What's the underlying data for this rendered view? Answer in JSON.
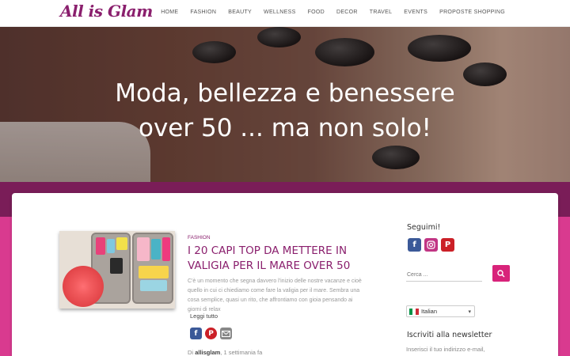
{
  "header": {
    "logo": "All is Glam",
    "nav": [
      "HOME",
      "FASHION",
      "BEAUTY",
      "WELLNESS",
      "FOOD",
      "DECOR",
      "TRAVEL",
      "EVENTS",
      "PROPOSTE SHOPPING"
    ]
  },
  "hero": {
    "line1": "Moda, bellezza e benessere",
    "line2": "over 50 ... ma non solo!"
  },
  "post": {
    "category": "FASHION",
    "title": "I 20 CAPI TOP DA METTERE IN VALIGIA PER IL MARE OVER 50",
    "excerpt": "C'è un momento che segna davvero l'inizio delle nostre vacanze e cioè quello in cui ci chiediamo come fare la valigia per il mare. Sembra una cosa semplice, quasi un rito, che affrontiamo con gioia pensando ai giorni di relax",
    "read_more": "Leggi tutto",
    "by_label": "Di",
    "author": "allisglam",
    "date": ", 1 settimania fa",
    "share_icons": [
      "facebook-icon",
      "pinterest-icon",
      "email-icon"
    ]
  },
  "sidebar": {
    "follow_title": "Seguimi!",
    "social_icons": [
      "facebook-icon",
      "instagram-icon",
      "pinterest-icon"
    ],
    "search_placeholder": "Cerca ...",
    "language": "Italian",
    "newsletter_title": "Iscriviti alla newsletter",
    "newsletter_text": "Inserisci il tuo indirizzo e-mail,"
  },
  "colors": {
    "brand": "#8a1f6d",
    "band_dark": "#7a1d58",
    "band_pink": "#d93a8f",
    "search_button": "#d8237a",
    "facebook": "#3b5998",
    "instagram": "#c13584",
    "pinterest": "#cb2027",
    "email": "#888888"
  }
}
